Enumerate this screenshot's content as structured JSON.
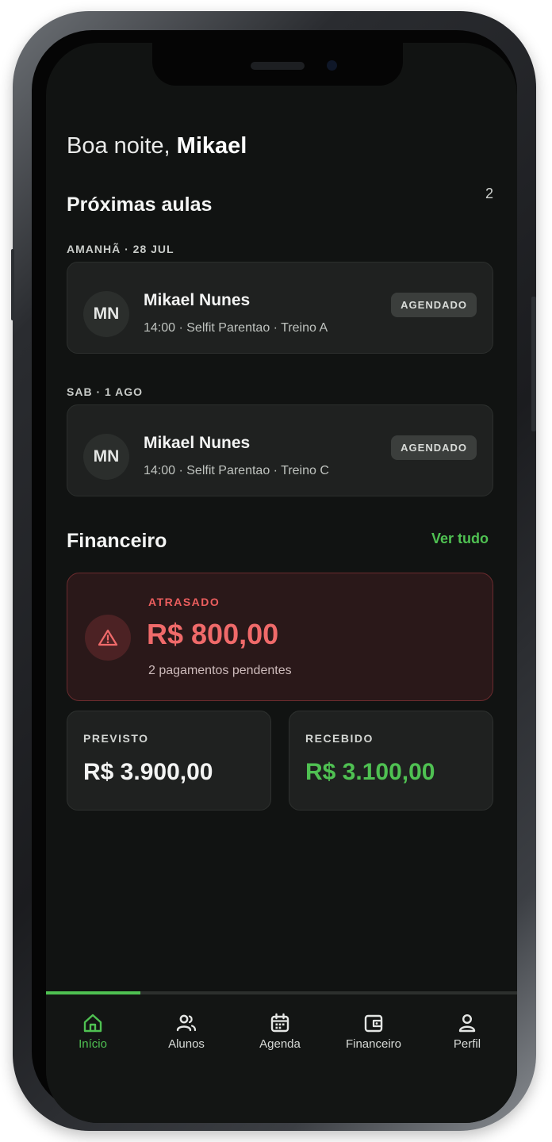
{
  "header": {
    "greeting_prefix": "Boa noite,",
    "user_name": "Mikael"
  },
  "classes": {
    "title": "Próximas aulas",
    "count": "2",
    "groups": [
      {
        "date_label": "AMANHÃ · 28 JUL",
        "initials": "MN",
        "name": "Mikael Nunes",
        "meta": "14:00 · Selfit Parentao · Treino A",
        "status": "AGENDADO"
      },
      {
        "date_label": "SAB · 1 AGO",
        "initials": "MN",
        "name": "Mikael Nunes",
        "meta": "14:00 · Selfit Parentao · Treino C",
        "status": "AGENDADO"
      }
    ]
  },
  "finance": {
    "title": "Financeiro",
    "see_all": "Ver tudo",
    "overdue": {
      "label": "ATRASADO",
      "value": "R$ 800,00",
      "subtitle": "2 pagamentos pendentes",
      "icon": "warning-triangle-icon"
    },
    "expected": {
      "label": "PREVISTO",
      "value": "R$ 3.900,00"
    },
    "received": {
      "label": "RECEBIDO",
      "value": "R$ 3.100,00"
    }
  },
  "tabbar": {
    "progress_fraction": 0.2,
    "tabs": [
      {
        "label": "Início",
        "icon": "home-icon",
        "active": true
      },
      {
        "label": "Alunos",
        "icon": "users-icon",
        "active": false
      },
      {
        "label": "Agenda",
        "icon": "calendar-icon",
        "active": false
      },
      {
        "label": "Financeiro",
        "icon": "wallet-icon",
        "active": false
      },
      {
        "label": "Perfil",
        "icon": "user-icon",
        "active": false
      }
    ]
  },
  "colors": {
    "accent": "#4fc152",
    "danger": "#f06a6a",
    "background": "#111312",
    "card": "#1f2120"
  }
}
